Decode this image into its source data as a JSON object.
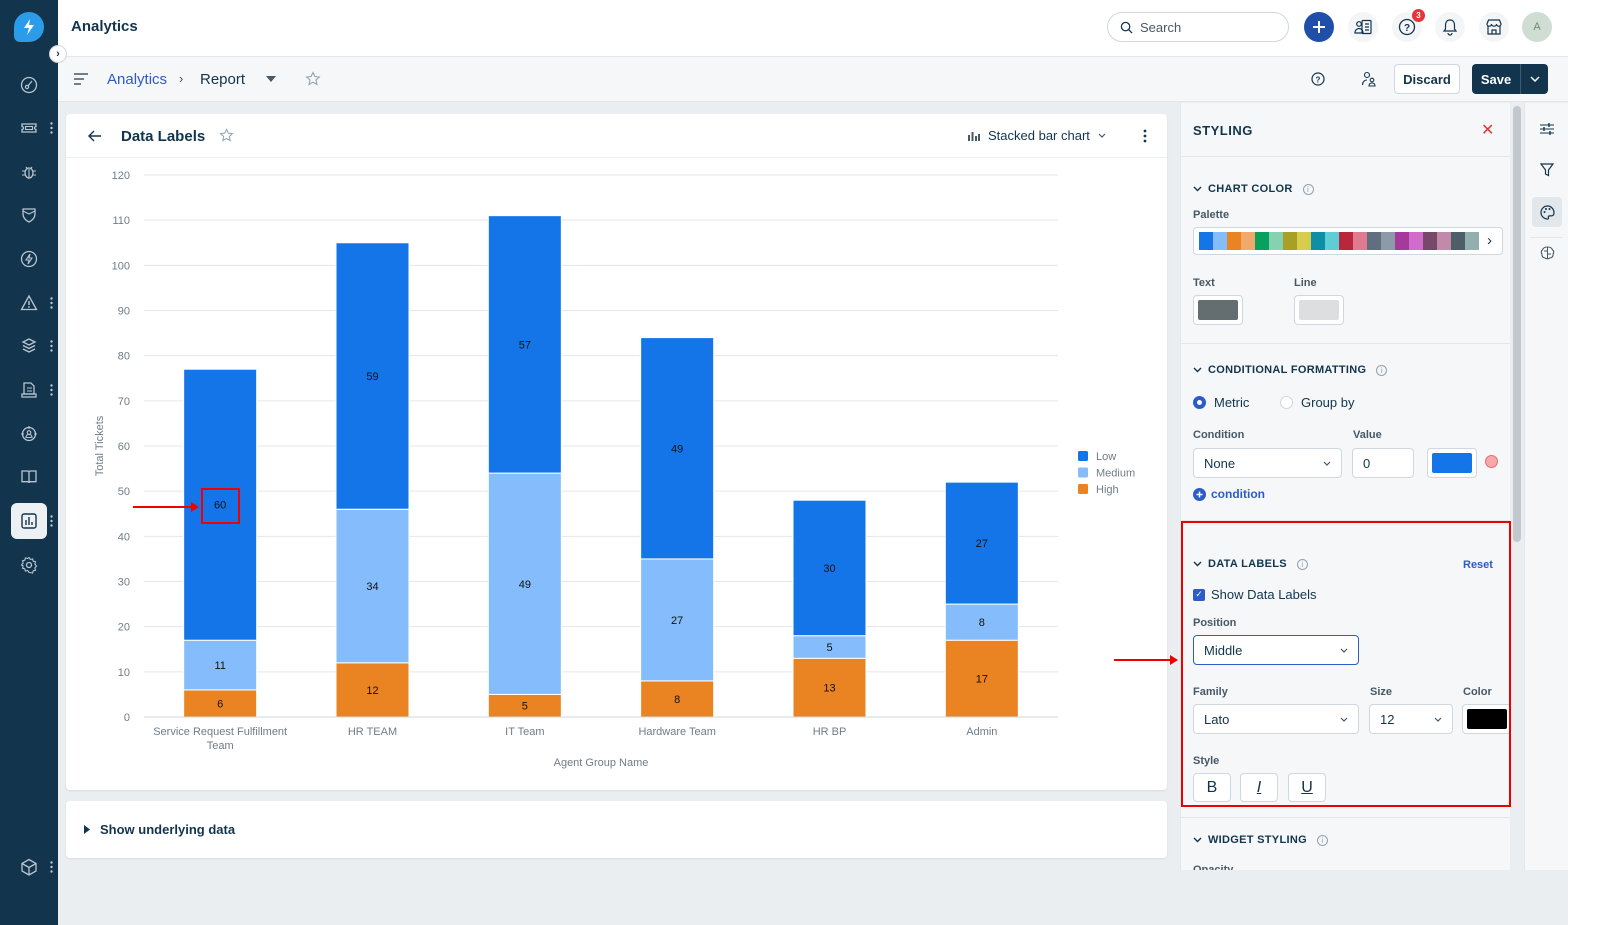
{
  "app": {
    "title": "Analytics"
  },
  "header": {
    "search_placeholder": "Search",
    "help_badge_count": "3",
    "avatar_initial": "A",
    "icons": [
      "plus-icon",
      "contacts-icon",
      "help-icon",
      "bell-icon",
      "marketplace-icon",
      "avatar"
    ]
  },
  "sidebar": {
    "items": [
      {
        "name": "dashboard",
        "icon": "gauge-icon"
      },
      {
        "name": "tickets",
        "icon": "ticket-icon",
        "menu": true
      },
      {
        "name": "problems",
        "icon": "bug-icon"
      },
      {
        "name": "changes",
        "icon": "shield-icon"
      },
      {
        "name": "releases",
        "icon": "bolt-icon"
      },
      {
        "name": "alerts",
        "icon": "alert-icon",
        "menu": true
      },
      {
        "name": "assets",
        "icon": "layers-icon",
        "menu": true
      },
      {
        "name": "contracts",
        "icon": "document-icon",
        "menu": true
      },
      {
        "name": "team",
        "icon": "people-icon"
      },
      {
        "name": "solutions",
        "icon": "book-icon"
      },
      {
        "name": "analytics",
        "icon": "chart-icon",
        "menu": true,
        "active": true
      },
      {
        "name": "admin",
        "icon": "gear-icon"
      }
    ],
    "bottom_item": {
      "name": "apps",
      "icon": "cube-icon",
      "menu": true
    }
  },
  "subheader": {
    "breadcrumb_parent": "Analytics",
    "breadcrumb_separator": "›",
    "breadcrumb_current": "Report",
    "discard_label": "Discard",
    "save_label": "Save"
  },
  "widget": {
    "title": "Data Labels",
    "chart_type_label": "Stacked bar chart",
    "show_underlying_label": "Show underlying data"
  },
  "chart_data": {
    "type": "bar",
    "stacked": true,
    "title": "Data Labels",
    "xlabel": "Agent Group Name",
    "ylabel": "Total Tickets",
    "ylim": [
      0,
      120
    ],
    "yticks": [
      0,
      10,
      20,
      30,
      40,
      50,
      60,
      70,
      80,
      90,
      100,
      110,
      120
    ],
    "grid": true,
    "legend_position": "right",
    "categories": [
      "Service Request Fulfillment Team",
      "HR TEAM",
      "IT Team",
      "Hardware Team",
      "HR BP",
      "Admin"
    ],
    "series": [
      {
        "name": "High",
        "color": "#ea8422",
        "values": [
          6,
          12,
          5,
          8,
          13,
          17
        ]
      },
      {
        "name": "Medium",
        "color": "#85bcfc",
        "values": [
          11,
          34,
          49,
          27,
          5,
          8
        ]
      },
      {
        "name": "Low",
        "color": "#1475e8",
        "values": [
          60,
          59,
          57,
          49,
          30,
          27
        ]
      }
    ],
    "legend_order": [
      "Low",
      "Medium",
      "High"
    ],
    "data_label_position": "middle"
  },
  "styling_panel": {
    "title": "STYLING",
    "chart_color": {
      "title": "CHART COLOR",
      "palette_label": "Palette",
      "palette": [
        "#1475e8",
        "#85bcfc",
        "#ea8422",
        "#f3a86b",
        "#08a05c",
        "#86d1b0",
        "#a79f26",
        "#d6cc4d",
        "#0f8fa5",
        "#5ecdd6",
        "#b8283a",
        "#e07a91",
        "#5f6f7f",
        "#8d9aa8",
        "#a6399c",
        "#d06cc9",
        "#77486a",
        "#c18aa8",
        "#4d5e68",
        "#93aeae"
      ],
      "text_label": "Text",
      "text_color": "#646d6f",
      "line_label": "Line",
      "line_color": "#dcdee0"
    },
    "conditional_formatting": {
      "title": "CONDITIONAL FORMATTING",
      "options": [
        "Metric",
        "Group by"
      ],
      "selected": "Metric",
      "condition_label": "Condition",
      "condition_value": "None",
      "value_label": "Value",
      "value_value": "0",
      "color": "#1475e8",
      "add_condition_label": "condition"
    },
    "data_labels": {
      "title": "DATA LABELS",
      "reset_label": "Reset",
      "show_label": "Show Data Labels",
      "show_checked": true,
      "position_label": "Position",
      "position_value": "Middle",
      "family_label": "Family",
      "family_value": "Lato",
      "size_label": "Size",
      "size_value": "12",
      "color_label": "Color",
      "color_value": "#000000",
      "style_label": "Style",
      "style_buttons": [
        "B",
        "I",
        "U"
      ]
    },
    "widget_styling": {
      "title": "WIDGET STYLING",
      "opacity_label": "Opacity"
    }
  },
  "right_rail": [
    "settings-sliders-icon",
    "filter-icon",
    "palette-icon",
    "brain-icon"
  ]
}
